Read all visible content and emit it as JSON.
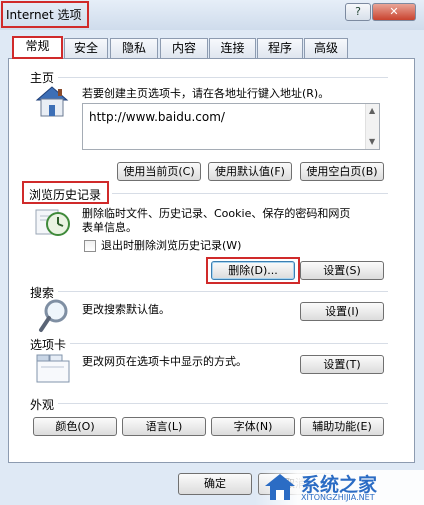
{
  "window": {
    "title": "Internet 选项",
    "help_label": "?",
    "close_label": "✕"
  },
  "tabs": [
    {
      "label": "常规",
      "active": true
    },
    {
      "label": "安全"
    },
    {
      "label": "隐私"
    },
    {
      "label": "内容"
    },
    {
      "label": "连接"
    },
    {
      "label": "程序"
    },
    {
      "label": "高级"
    }
  ],
  "homepage": {
    "title": "主页",
    "desc": "若要创建主页选项卡，请在各地址行键入地址(R)。",
    "url": "http://www.baidu.com/",
    "btn_current": "使用当前页(C)",
    "btn_default": "使用默认值(F)",
    "btn_blank": "使用空白页(B)"
  },
  "history": {
    "title": "浏览历史记录",
    "desc_line1": "删除临时文件、历史记录、Cookie、保存的密码和网页",
    "desc_line2": "表单信息。",
    "checkbox_label": "退出时删除浏览历史记录(W)",
    "btn_delete": "删除(D)...",
    "btn_settings": "设置(S)"
  },
  "search": {
    "title": "搜索",
    "desc": "更改搜索默认值。",
    "btn_settings": "设置(I)"
  },
  "tabs_section": {
    "title": "选项卡",
    "desc": "更改网页在选项卡中显示的方式。",
    "btn_settings": "设置(T)"
  },
  "appearance": {
    "title": "外观",
    "btn_colors": "颜色(O)",
    "btn_languages": "语言(L)",
    "btn_fonts": "字体(N)",
    "btn_accessibility": "辅助功能(E)"
  },
  "footer": {
    "btn_ok": "确定",
    "btn_cancel": "取消"
  },
  "watermark": {
    "brand": "系统之家",
    "url": "XITONGZHIJIA.NET"
  },
  "colors": {
    "highlight": "#d02a2a",
    "focus": "#3c7fb1"
  }
}
